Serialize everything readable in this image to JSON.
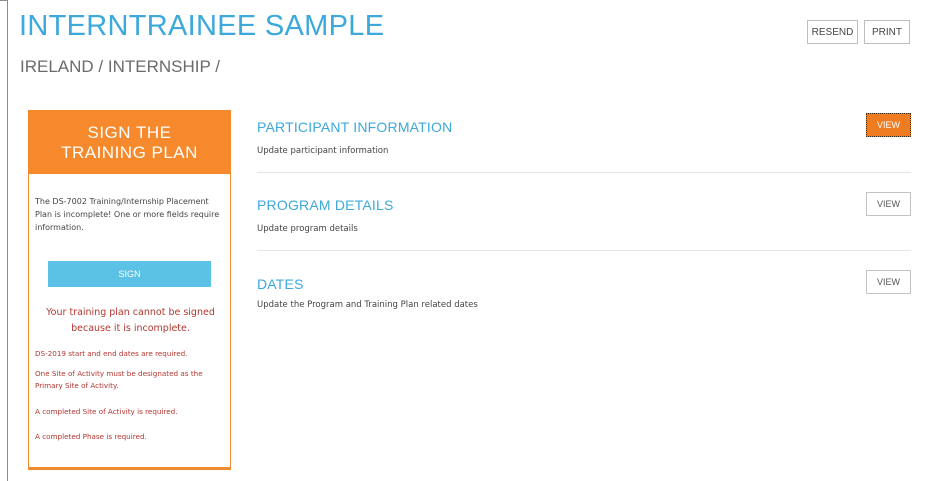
{
  "header": {
    "title": "INTERNTRAINEE SAMPLE",
    "breadcrumb": "IRELAND / INTERNSHIP /",
    "resend_label": "RESEND",
    "print_label": "PRINT"
  },
  "sign_panel": {
    "heading": "SIGN THE TRAINING PLAN",
    "intro": "The DS-7002 Training/Internship Placement Plan is incomplete! One or more fields require information.",
    "sign_label": "SIGN",
    "error_main": "Your training plan cannot be signed because it is incomplete.",
    "errors": [
      "DS-2019 start and end dates are required.",
      "One Site of Activity must be designated as the Primary Site of Activity.",
      "A completed Site of Activity is required.",
      "A completed Phase is required."
    ]
  },
  "sections": [
    {
      "title": "PARTICIPANT INFORMATION",
      "description": "Update participant information",
      "button": "VIEW"
    },
    {
      "title": "PROGRAM DETAILS",
      "description": "Update program details",
      "button": "VIEW"
    },
    {
      "title": "DATES",
      "description": "Update the Program and Training Plan related dates",
      "button": "VIEW"
    }
  ],
  "colors": {
    "accent_blue": "#3da8db",
    "accent_orange": "#f6892c",
    "error_red": "#b5362f",
    "sign_button": "#5bc2e5"
  }
}
